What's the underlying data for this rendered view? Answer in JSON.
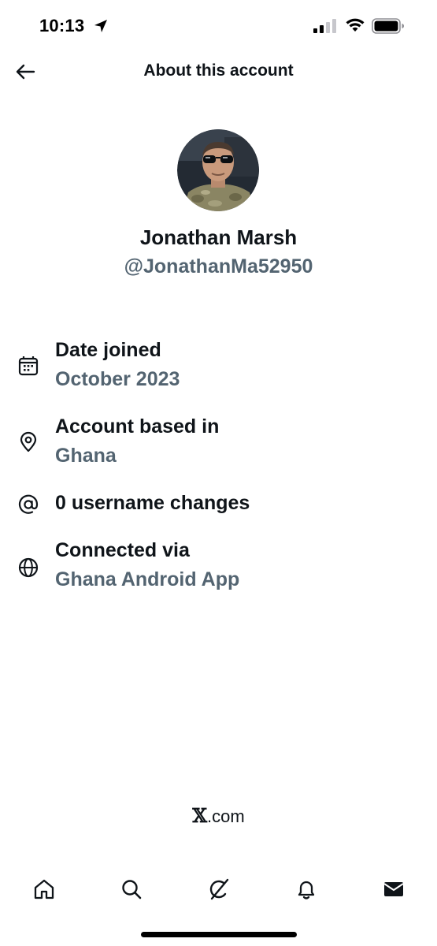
{
  "status_bar": {
    "time": "10:13",
    "icons": [
      "location-arrow-icon",
      "cellular-signal-icon",
      "wifi-icon",
      "battery-icon"
    ]
  },
  "header": {
    "title": "About this account",
    "back_icon": "arrow-left-icon"
  },
  "profile": {
    "display_name": "Jonathan Marsh",
    "handle": "@JonathanMa52950",
    "avatar_description": "profile photo"
  },
  "info": {
    "date_joined": {
      "icon": "calendar-icon",
      "label": "Date joined",
      "value": "October 2023"
    },
    "account_based_in": {
      "icon": "location-pin-icon",
      "label": "Account based in",
      "value": "Ghana"
    },
    "username_changes": {
      "icon": "at-sign-icon",
      "label": "0 username changes"
    },
    "connected_via": {
      "icon": "globe-icon",
      "label": "Connected via",
      "value": "Ghana Android App"
    }
  },
  "footer": {
    "brand_mark": "𝕏",
    "brand_suffix": ".com"
  },
  "tab_bar": {
    "tabs": [
      "home-icon",
      "search-icon",
      "grok-icon",
      "notifications-bell-icon",
      "messages-envelope-icon"
    ],
    "active_tab": "messages-envelope-icon"
  },
  "colors": {
    "primary_text": "#0f1419",
    "secondary_text": "#536471",
    "background": "#ffffff"
  }
}
